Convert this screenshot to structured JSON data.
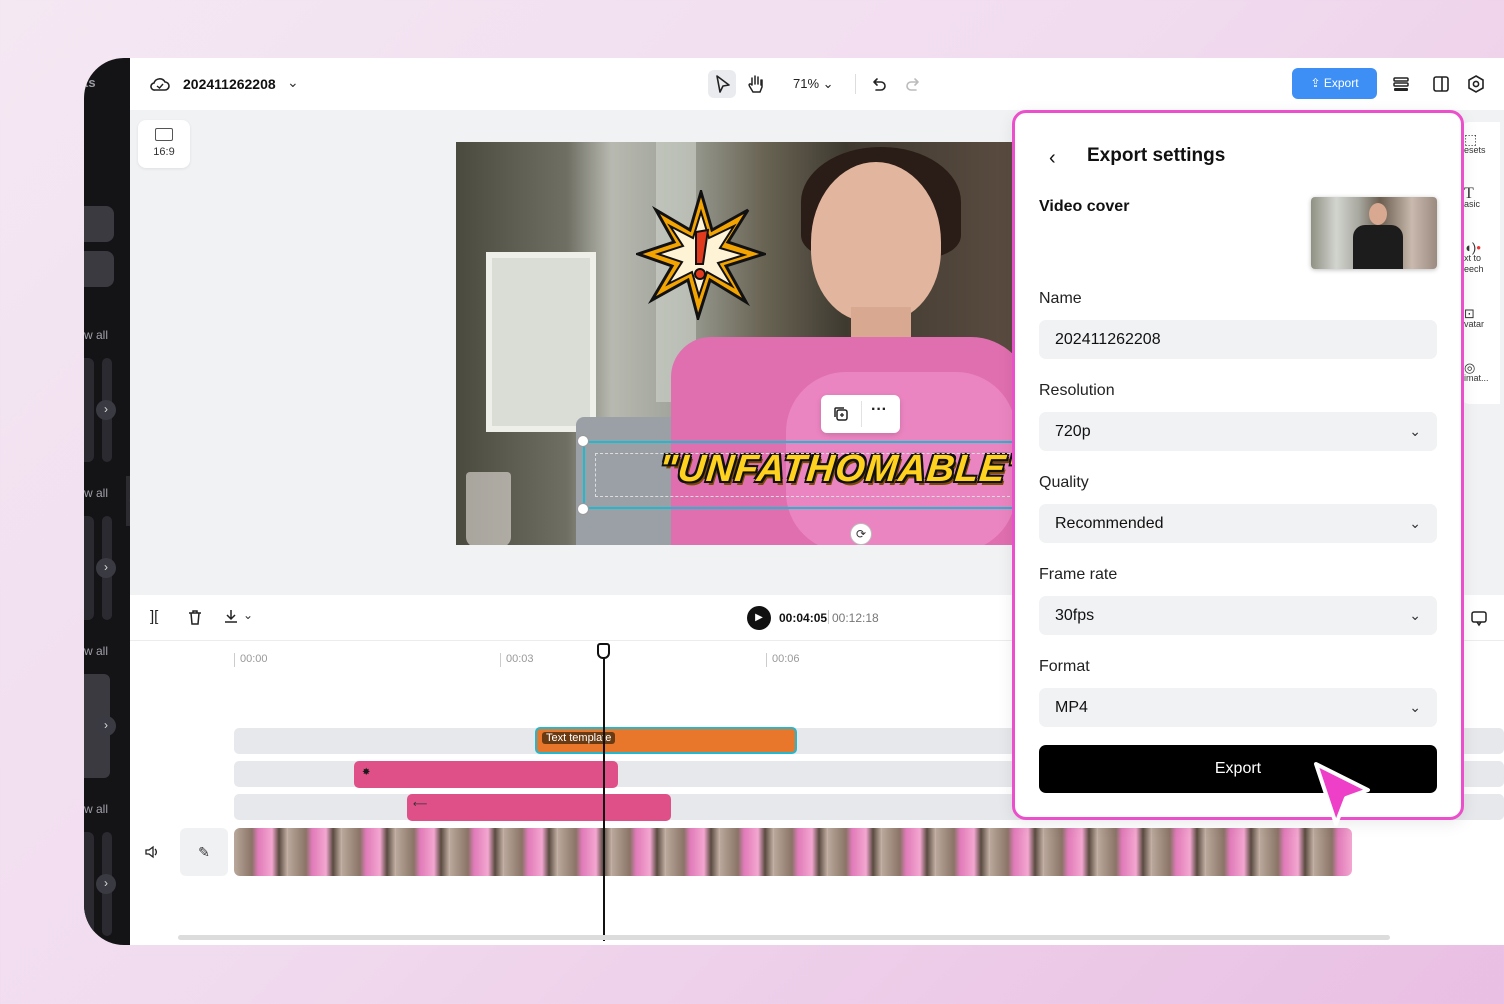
{
  "left_panel": {
    "title_fragment": "ts",
    "view_all_labels": [
      "w all",
      "w all",
      "w all",
      "w all"
    ]
  },
  "topbar": {
    "project_name": "202411262208",
    "zoom": "71%",
    "export_label": "Export"
  },
  "canvas": {
    "ratio_label": "16:9",
    "headline_text": "\"UNFATHOMABLE\""
  },
  "right_strip": {
    "items": [
      "esets",
      "asic",
      "xt to eech",
      "vatar",
      "imat..."
    ]
  },
  "timeline": {
    "current_time": "00:04:05",
    "total_time": "00:12:18",
    "ruler": [
      "00:00",
      "00:03",
      "00:06"
    ],
    "text_clip_label": "Text template"
  },
  "export_panel": {
    "title": "Export settings",
    "video_cover_label": "Video cover",
    "name_label": "Name",
    "name_value": "202411262208",
    "resolution_label": "Resolution",
    "resolution_value": "720p",
    "quality_label": "Quality",
    "quality_value": "Recommended",
    "frame_rate_label": "Frame rate",
    "frame_rate_value": "30fps",
    "format_label": "Format",
    "format_value": "MP4",
    "export_button": "Export"
  },
  "colors": {
    "accent_blue": "#3d8ff5",
    "panel_border_pink": "#ec4fcb",
    "clip_orange": "#e8762b",
    "clip_pink": "#df4f88",
    "selection_cyan": "#22b8cf"
  }
}
